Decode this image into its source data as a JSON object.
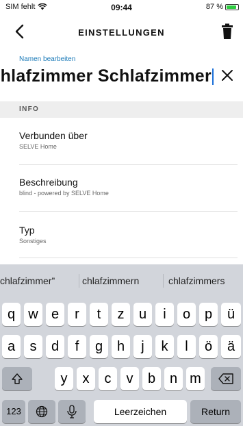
{
  "status_bar": {
    "carrier": "SIM fehlt",
    "time": "09:44",
    "battery_percent": "87 %",
    "battery_level": 0.87
  },
  "nav": {
    "title": "EINSTELLUNGEN",
    "back_icon": "chevron-left-icon",
    "delete_icon": "trash-icon"
  },
  "edit": {
    "label": "Namen bearbeiten",
    "value": "hlafzimmer  Schlafzimmer",
    "clear_icon": "close-icon"
  },
  "info": {
    "section_title": "INFO",
    "items": [
      {
        "title": "Verbunden über",
        "value": "SELVE Home"
      },
      {
        "title": "Beschreibung",
        "value": "blind - powered by SELVE Home"
      },
      {
        "title": "Typ",
        "value": "Sonstiges"
      }
    ]
  },
  "keyboard": {
    "suggestions": [
      "chlafzimmer”",
      "chlafzimmern",
      "chlafzimmers"
    ],
    "row1": [
      "q",
      "w",
      "e",
      "r",
      "t",
      "z",
      "u",
      "i",
      "o",
      "p",
      "ü"
    ],
    "row2": [
      "a",
      "s",
      "d",
      "f",
      "g",
      "h",
      "j",
      "k",
      "l",
      "ö",
      "ä"
    ],
    "row3": [
      "y",
      "x",
      "c",
      "v",
      "b",
      "n",
      "m"
    ],
    "numbers_label": "123",
    "space_label": "Leerzeichen",
    "return_label": "Return",
    "shift_icon": "shift-icon",
    "delete_icon": "backspace-icon",
    "globe_icon": "globe-icon",
    "mic_icon": "microphone-icon"
  }
}
